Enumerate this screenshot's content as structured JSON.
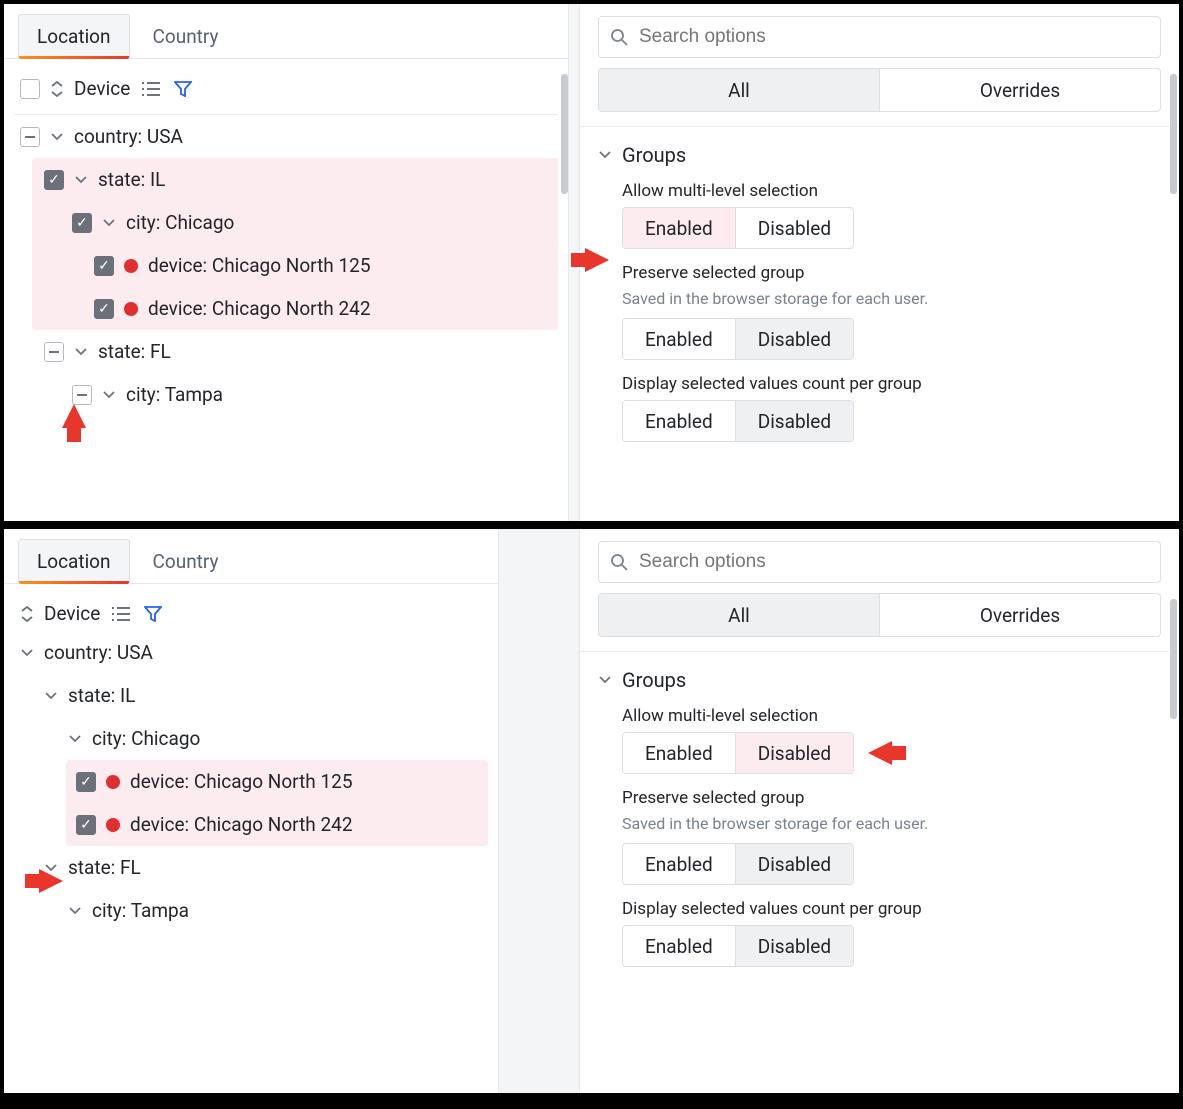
{
  "tabs": {
    "location": "Location",
    "country": "Country"
  },
  "tree": {
    "header": "Device",
    "country_usa": "country: USA",
    "state_il": "state: IL",
    "city_chicago": "city: Chicago",
    "device_chi_125": "device: Chicago North 125",
    "device_chi_242": "device: Chicago North 242",
    "state_fl": "state: FL",
    "city_tampa": "city: Tampa"
  },
  "right": {
    "search_placeholder": "Search options",
    "seg_all": "All",
    "seg_overrides": "Overrides",
    "section_groups": "Groups",
    "opt_multi_label": "Allow multi-level selection",
    "opt_preserve_label": "Preserve selected group",
    "opt_preserve_help": "Saved in the browser storage for each user.",
    "opt_count_label": "Display selected values count per group",
    "enabled": "Enabled",
    "disabled": "Disabled"
  }
}
